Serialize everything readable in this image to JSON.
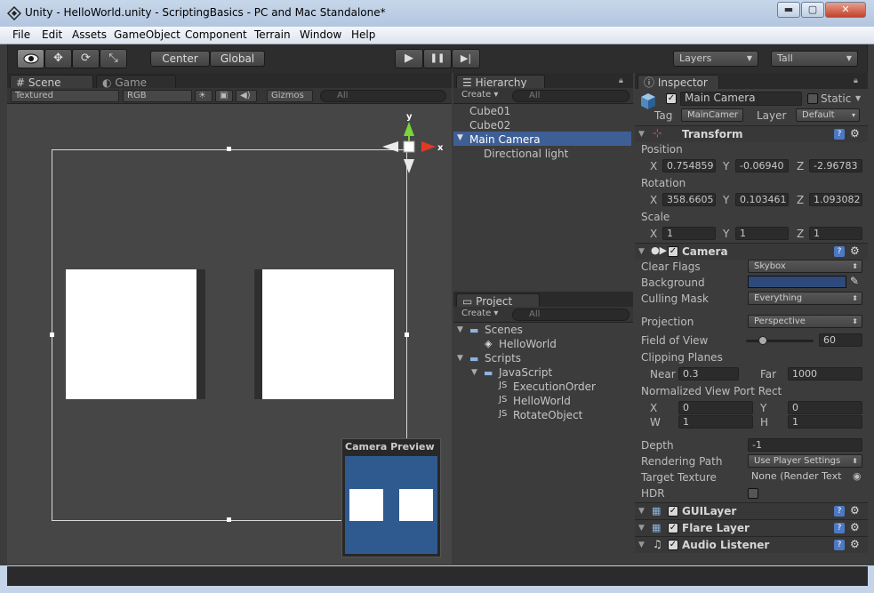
{
  "window": {
    "title": "Unity - HelloWorld.unity - ScriptingBasics - PC and Mac Standalone*",
    "min": "▬",
    "max": "▢",
    "close": "✕"
  },
  "menu": [
    "File",
    "Edit",
    "Assets",
    "GameObject",
    "Component",
    "Terrain",
    "Window",
    "Help"
  ],
  "toolbar": {
    "tools": [
      "eye-icon",
      "move-icon",
      "rotate-icon",
      "scale-icon"
    ],
    "pivot": "Center",
    "space": "Global",
    "play": "▶",
    "pause": "❚❚",
    "step": "▶|",
    "layers": "Layers",
    "layout": "Tall"
  },
  "scene": {
    "tab_scene": "Scene",
    "tab_game": "Game",
    "render_mode": "Textured",
    "color_mode": "RGB",
    "gizmos": "Gizmos",
    "search": "All",
    "gizmo_y": "y",
    "gizmo_x": "x",
    "preview_title": "Camera Preview",
    "preview_bg": "#2f5a8f"
  },
  "hierarchy": {
    "tab": "Hierarchy",
    "create": "Create",
    "search": "All",
    "items": [
      {
        "label": "Cube01",
        "indent": 0,
        "selected": false
      },
      {
        "label": "Cube02",
        "indent": 0,
        "selected": false
      },
      {
        "label": "Main Camera",
        "indent": 0,
        "selected": true
      },
      {
        "label": "Directional light",
        "indent": 1,
        "selected": false
      }
    ]
  },
  "project": {
    "tab": "Project",
    "create": "Create",
    "search": "All",
    "items": [
      {
        "label": "Scenes",
        "type": "folder",
        "indent": 0
      },
      {
        "label": "HelloWorld",
        "type": "unity",
        "indent": 1
      },
      {
        "label": "Scripts",
        "type": "folder",
        "indent": 0
      },
      {
        "label": "JavaScript",
        "type": "folder",
        "indent": 1
      },
      {
        "label": "ExecutionOrder",
        "type": "script",
        "indent": 2
      },
      {
        "label": "HelloWorld",
        "type": "script",
        "indent": 2
      },
      {
        "label": "RotateObject",
        "type": "script",
        "indent": 2
      }
    ]
  },
  "inspector": {
    "tab": "Inspector",
    "name": "Main Camera",
    "static": "Static",
    "tag_label": "Tag",
    "tag": "MainCamer",
    "layer_label": "Layer",
    "layer": "Default",
    "transform": {
      "title": "Transform",
      "position_label": "Position",
      "position": {
        "x": "0.754859",
        "y": "-0.06940",
        "z": "-2.96783"
      },
      "rotation_label": "Rotation",
      "rotation": {
        "x": "358.6605",
        "y": "0.103461",
        "z": "1.093082"
      },
      "scale_label": "Scale",
      "scale": {
        "x": "1",
        "y": "1",
        "z": "1"
      },
      "x": "X",
      "y": "Y",
      "z": "Z"
    },
    "camera": {
      "title": "Camera",
      "clear_flags_label": "Clear Flags",
      "clear_flags": "Skybox",
      "background_label": "Background",
      "background_color": "#2f4a7a",
      "culling_mask_label": "Culling Mask",
      "culling_mask": "Everything",
      "projection_label": "Projection",
      "projection": "Perspective",
      "fov_label": "Field of View",
      "fov": "60",
      "fov_fraction": 0.25,
      "clipping_label": "Clipping Planes",
      "near_label": "Near",
      "near": "0.3",
      "far_label": "Far",
      "far": "1000",
      "viewport_label": "Normalized View Port Rect",
      "vx_label": "X",
      "vx": "0",
      "vy_label": "Y",
      "vy": "0",
      "vw_label": "W",
      "vw": "1",
      "vh_label": "H",
      "vh": "1",
      "depth_label": "Depth",
      "depth": "-1",
      "rendering_path_label": "Rendering Path",
      "rendering_path": "Use Player Settings",
      "target_texture_label": "Target Texture",
      "target_texture": "None (Render Text",
      "hdr_label": "HDR"
    },
    "components": [
      "GUILayer",
      "Flare Layer",
      "Audio Listener"
    ]
  }
}
